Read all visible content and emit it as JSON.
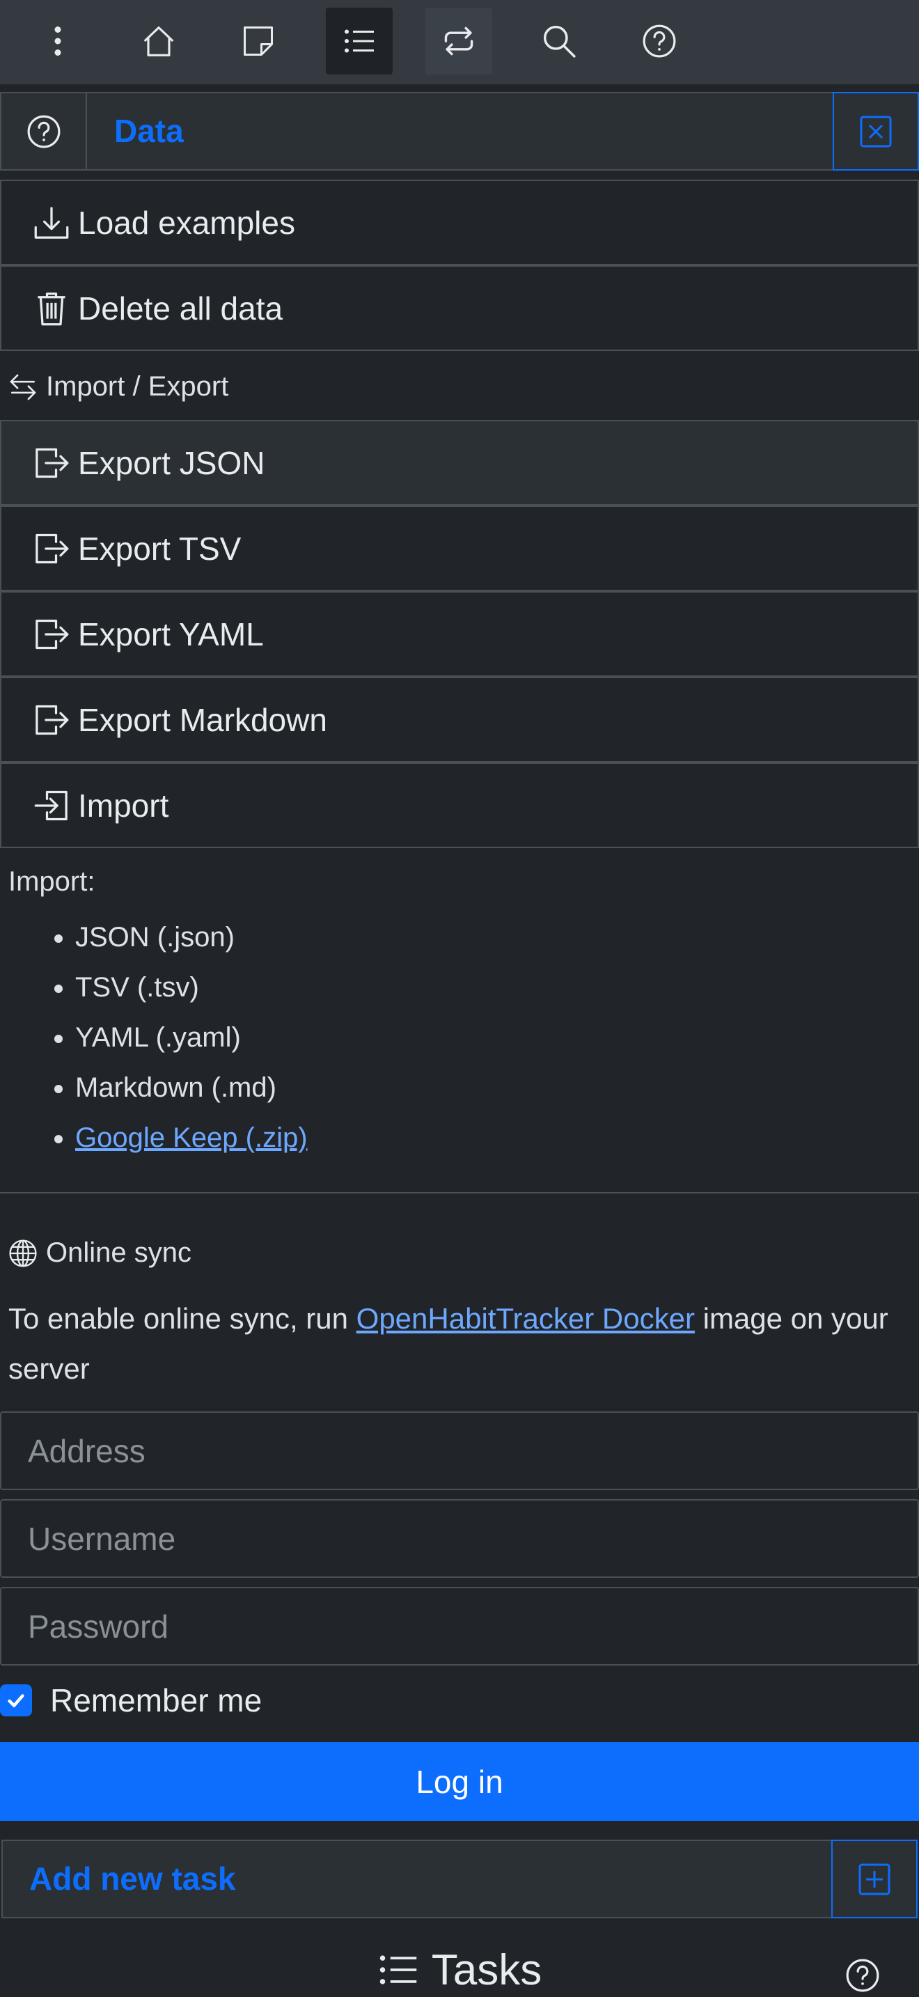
{
  "toolbar": {
    "items": [
      {
        "name": "menu-icon"
      },
      {
        "name": "home-icon"
      },
      {
        "name": "sticky-note-icon"
      },
      {
        "name": "list-icon",
        "active": true
      },
      {
        "name": "repeat-icon"
      },
      {
        "name": "search-icon"
      },
      {
        "name": "help-icon"
      }
    ]
  },
  "panel": {
    "title": "Data"
  },
  "data_actions": {
    "load_examples": "Load examples",
    "delete_all": "Delete all data"
  },
  "import_export": {
    "heading": "Import / Export",
    "export_json": "Export JSON",
    "export_tsv": "Export TSV",
    "export_yaml": "Export YAML",
    "export_markdown": "Export Markdown",
    "import": "Import",
    "formats_label": "Import:",
    "formats": [
      "JSON (.json)",
      "TSV (.tsv)",
      "YAML (.yaml)",
      "Markdown (.md)"
    ],
    "formats_link": "Google Keep (.zip)"
  },
  "sync": {
    "heading": "Online sync",
    "text_before": "To enable online sync, run ",
    "link": "OpenHabitTracker Docker",
    "text_after": " image on your server",
    "address_placeholder": "Address",
    "username_placeholder": "Username",
    "password_placeholder": "Password",
    "remember_me": "Remember me",
    "remember_checked": true,
    "login": "Log in"
  },
  "tasks": {
    "add_new": "Add new task",
    "title": "Tasks"
  },
  "colors": {
    "accent": "#0d6efd",
    "link": "#6ea8fe",
    "background": "#212529",
    "toolbar": "#343a40",
    "border": "#495057"
  }
}
